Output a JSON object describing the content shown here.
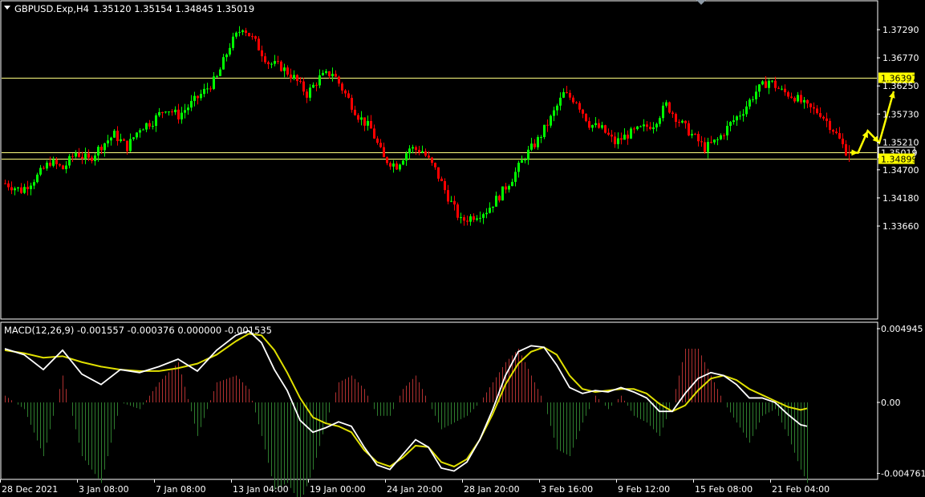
{
  "window": {
    "title": "GBPUSD.Exp,H4",
    "ohlc": "1.35120 1.35154 1.34845 1.35019"
  },
  "indicator": {
    "label": "MACD(12,26,9) -0.001557 -0.000376 0.000000 -0.001535"
  },
  "colors": {
    "background": "#000000",
    "frame": "#ffffff",
    "bull_candle": "#00ff00",
    "bear_candle": "#ff0000",
    "level_line": "#ffff80",
    "label_bg": "#ffff00",
    "projection": "#ffff00",
    "macd_line": "#ffffff",
    "signal_line": "#e0e000",
    "hist_pos": "#b03030",
    "hist_neg": "#2e7d2e"
  },
  "chart_data": {
    "type": "candlestick",
    "price_axis": {
      "ticks": [
        "1.37290",
        "1.36770",
        "1.36250",
        "1.35730",
        "1.35210",
        "1.34700",
        "1.34180",
        "1.33660"
      ],
      "range": [
        1.3325,
        1.3775
      ]
    },
    "levels": [
      {
        "value": 1.36397,
        "label": "1.36397",
        "highlight": true
      },
      {
        "value": 1.35019,
        "label": "1.35019",
        "highlight": false
      },
      {
        "value": 1.34899,
        "label": "1.34899",
        "highlight": true
      }
    ],
    "x_axis": {
      "labels": [
        "28 Dec 2021",
        "3 Jan 08:00",
        "7 Jan 08:00",
        "13 Jan 04:00",
        "19 Jan 00:00",
        "24 Jan 20:00",
        "28 Jan 20:00",
        "3 Feb 16:00",
        "9 Feb 12:00",
        "15 Feb 08:00",
        "21 Feb 04:00"
      ]
    },
    "price_path": [
      [
        0,
        1.3445
      ],
      [
        5,
        1.3432
      ],
      [
        10,
        1.3458
      ],
      [
        14,
        1.3485
      ],
      [
        18,
        1.3472
      ],
      [
        22,
        1.3502
      ],
      [
        26,
        1.3488
      ],
      [
        30,
        1.3515
      ],
      [
        34,
        1.3535
      ],
      [
        38,
        1.3512
      ],
      [
        42,
        1.3548
      ],
      [
        46,
        1.356
      ],
      [
        50,
        1.3585
      ],
      [
        54,
        1.357
      ],
      [
        58,
        1.3592
      ],
      [
        62,
        1.3615
      ],
      [
        66,
        1.364
      ],
      [
        70,
        1.37
      ],
      [
        74,
        1.3735
      ],
      [
        78,
        1.3705
      ],
      [
        82,
        1.3668
      ],
      [
        86,
        1.366
      ],
      [
        90,
        1.364
      ],
      [
        94,
        1.361
      ],
      [
        98,
        1.364
      ],
      [
        102,
        1.365
      ],
      [
        106,
        1.361
      ],
      [
        110,
        1.357
      ],
      [
        114,
        1.3545
      ],
      [
        118,
        1.349
      ],
      [
        122,
        1.3478
      ],
      [
        126,
        1.351
      ],
      [
        130,
        1.3505
      ],
      [
        134,
        1.347
      ],
      [
        138,
        1.342
      ],
      [
        142,
        1.3375
      ],
      [
        146,
        1.3385
      ],
      [
        150,
        1.3395
      ],
      [
        154,
        1.3422
      ],
      [
        158,
        1.3455
      ],
      [
        162,
        1.3495
      ],
      [
        166,
        1.3525
      ],
      [
        170,
        1.3565
      ],
      [
        174,
        1.361
      ],
      [
        178,
        1.3598
      ],
      [
        182,
        1.3555
      ],
      [
        186,
        1.3545
      ],
      [
        190,
        1.352
      ],
      [
        194,
        1.3535
      ],
      [
        198,
        1.3545
      ],
      [
        202,
        1.3555
      ],
      [
        206,
        1.359
      ],
      [
        210,
        1.356
      ],
      [
        214,
        1.3535
      ],
      [
        218,
        1.351
      ],
      [
        222,
        1.3525
      ],
      [
        226,
        1.3555
      ],
      [
        230,
        1.358
      ],
      [
        234,
        1.3615
      ],
      [
        238,
        1.3635
      ],
      [
        242,
        1.3615
      ],
      [
        246,
        1.3605
      ],
      [
        250,
        1.3585
      ],
      [
        254,
        1.3575
      ],
      [
        258,
        1.3545
      ],
      [
        262,
        1.3505
      ]
    ],
    "projection_path": [
      [
        1.35019,
        0
      ],
      [
        1.35015,
        1.6
      ],
      [
        1.3542,
        3.6
      ],
      [
        1.352,
        6.0
      ],
      [
        1.3615,
        9.0
      ]
    ],
    "macd_axis": {
      "ticks": [
        "0.004945",
        "0.00",
        "-0.004761"
      ],
      "range": [
        -0.005,
        0.0052
      ]
    },
    "macd_path": [
      [
        0,
        0.0036
      ],
      [
        6,
        0.0032
      ],
      [
        12,
        0.0022
      ],
      [
        18,
        0.0035
      ],
      [
        24,
        0.0019
      ],
      [
        30,
        0.0012
      ],
      [
        36,
        0.0022
      ],
      [
        42,
        0.002
      ],
      [
        48,
        0.0024
      ],
      [
        54,
        0.0029
      ],
      [
        60,
        0.0021
      ],
      [
        66,
        0.0035
      ],
      [
        72,
        0.0045
      ],
      [
        76,
        0.0048
      ],
      [
        80,
        0.004
      ],
      [
        84,
        0.0022
      ],
      [
        88,
        0.0008
      ],
      [
        92,
        -0.0012
      ],
      [
        96,
        -0.002
      ],
      [
        100,
        -0.0017
      ],
      [
        104,
        -0.0013
      ],
      [
        108,
        -0.0016
      ],
      [
        112,
        -0.003
      ],
      [
        116,
        -0.0042
      ],
      [
        120,
        -0.0045
      ],
      [
        124,
        -0.0035
      ],
      [
        128,
        -0.0025
      ],
      [
        132,
        -0.003
      ],
      [
        136,
        -0.0044
      ],
      [
        140,
        -0.0046
      ],
      [
        144,
        -0.004
      ],
      [
        148,
        -0.0025
      ],
      [
        152,
        -0.0005
      ],
      [
        156,
        0.0018
      ],
      [
        160,
        0.0034
      ],
      [
        164,
        0.0038
      ],
      [
        168,
        0.0037
      ],
      [
        172,
        0.0025
      ],
      [
        176,
        0.001
      ],
      [
        180,
        0.0006
      ],
      [
        184,
        0.0008
      ],
      [
        188,
        0.0007
      ],
      [
        192,
        0.001
      ],
      [
        196,
        0.0007
      ],
      [
        200,
        0.0003
      ],
      [
        204,
        -0.0006
      ],
      [
        208,
        -0.0006
      ],
      [
        212,
        0.0006
      ],
      [
        216,
        0.0016
      ],
      [
        220,
        0.002
      ],
      [
        224,
        0.0018
      ],
      [
        228,
        0.0012
      ],
      [
        232,
        0.0003
      ],
      [
        236,
        0.0003
      ],
      [
        240,
        0.0
      ],
      [
        244,
        -0.0008
      ],
      [
        248,
        -0.0015
      ],
      [
        250,
        -0.0016
      ]
    ],
    "signal_path": [
      [
        0,
        0.0035
      ],
      [
        6,
        0.0033
      ],
      [
        12,
        0.003
      ],
      [
        18,
        0.0031
      ],
      [
        24,
        0.0027
      ],
      [
        30,
        0.0024
      ],
      [
        36,
        0.0022
      ],
      [
        42,
        0.0021
      ],
      [
        48,
        0.0021
      ],
      [
        54,
        0.0023
      ],
      [
        60,
        0.0026
      ],
      [
        66,
        0.0032
      ],
      [
        72,
        0.0041
      ],
      [
        76,
        0.0046
      ],
      [
        80,
        0.0045
      ],
      [
        84,
        0.0035
      ],
      [
        88,
        0.002
      ],
      [
        92,
        0.0003
      ],
      [
        96,
        -0.001
      ],
      [
        100,
        -0.0014
      ],
      [
        104,
        -0.0016
      ],
      [
        108,
        -0.002
      ],
      [
        112,
        -0.0032
      ],
      [
        116,
        -0.004
      ],
      [
        120,
        -0.0043
      ],
      [
        124,
        -0.0037
      ],
      [
        128,
        -0.0029
      ],
      [
        132,
        -0.003
      ],
      [
        136,
        -0.004
      ],
      [
        140,
        -0.0043
      ],
      [
        144,
        -0.0038
      ],
      [
        148,
        -0.0025
      ],
      [
        152,
        -0.0008
      ],
      [
        156,
        0.0012
      ],
      [
        160,
        0.0026
      ],
      [
        164,
        0.0034
      ],
      [
        168,
        0.0037
      ],
      [
        172,
        0.0032
      ],
      [
        176,
        0.0018
      ],
      [
        180,
        0.0009
      ],
      [
        184,
        0.0007
      ],
      [
        188,
        0.0008
      ],
      [
        192,
        0.0009
      ],
      [
        196,
        0.0009
      ],
      [
        200,
        0.0006
      ],
      [
        204,
        -0.0001
      ],
      [
        208,
        -0.0006
      ],
      [
        212,
        -0.0002
      ],
      [
        216,
        0.0008
      ],
      [
        220,
        0.0016
      ],
      [
        224,
        0.0018
      ],
      [
        228,
        0.0015
      ],
      [
        232,
        0.0009
      ],
      [
        236,
        0.0005
      ],
      [
        240,
        0.0001
      ],
      [
        244,
        -0.0003
      ],
      [
        248,
        -0.0005
      ],
      [
        250,
        -0.0004
      ]
    ]
  }
}
